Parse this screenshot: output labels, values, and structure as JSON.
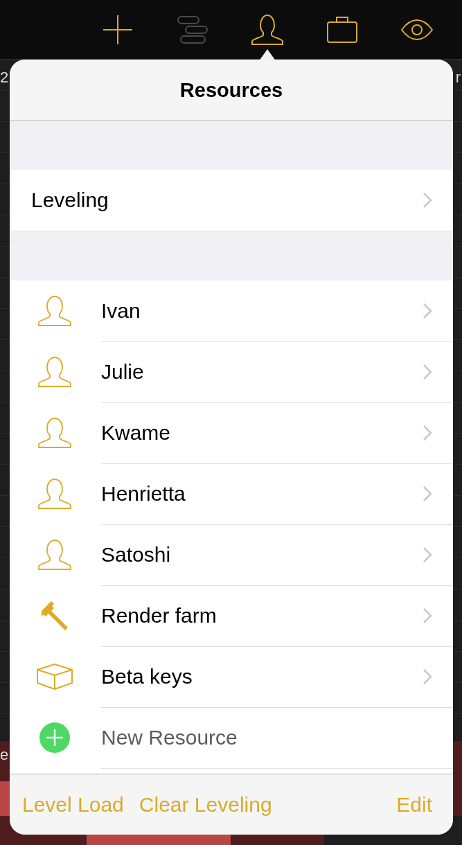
{
  "toolbar": {
    "buttons": [
      {
        "kind": "add",
        "disabled": false
      },
      {
        "kind": "gantt",
        "disabled": true
      },
      {
        "kind": "person",
        "disabled": false
      },
      {
        "kind": "briefcase",
        "disabled": false
      },
      {
        "kind": "eye",
        "disabled": false
      }
    ]
  },
  "background": {
    "top_left_text": "2",
    "top_right_text": "r",
    "lower_left_text": "e"
  },
  "popover": {
    "title": "Resources",
    "leveling": {
      "label": "Leveling"
    },
    "resources": [
      {
        "name": "Ivan",
        "kind": "person"
      },
      {
        "name": "Julie",
        "kind": "person"
      },
      {
        "name": "Kwame",
        "kind": "person"
      },
      {
        "name": "Henrietta",
        "kind": "person"
      },
      {
        "name": "Satoshi",
        "kind": "person"
      },
      {
        "name": "Render farm",
        "kind": "equipment"
      },
      {
        "name": "Beta keys",
        "kind": "material"
      },
      {
        "name": "New Resource",
        "kind": "new"
      }
    ],
    "bottom_buttons": {
      "left": [
        "Level Load",
        "Clear Leveling"
      ],
      "right": "Edit"
    }
  }
}
